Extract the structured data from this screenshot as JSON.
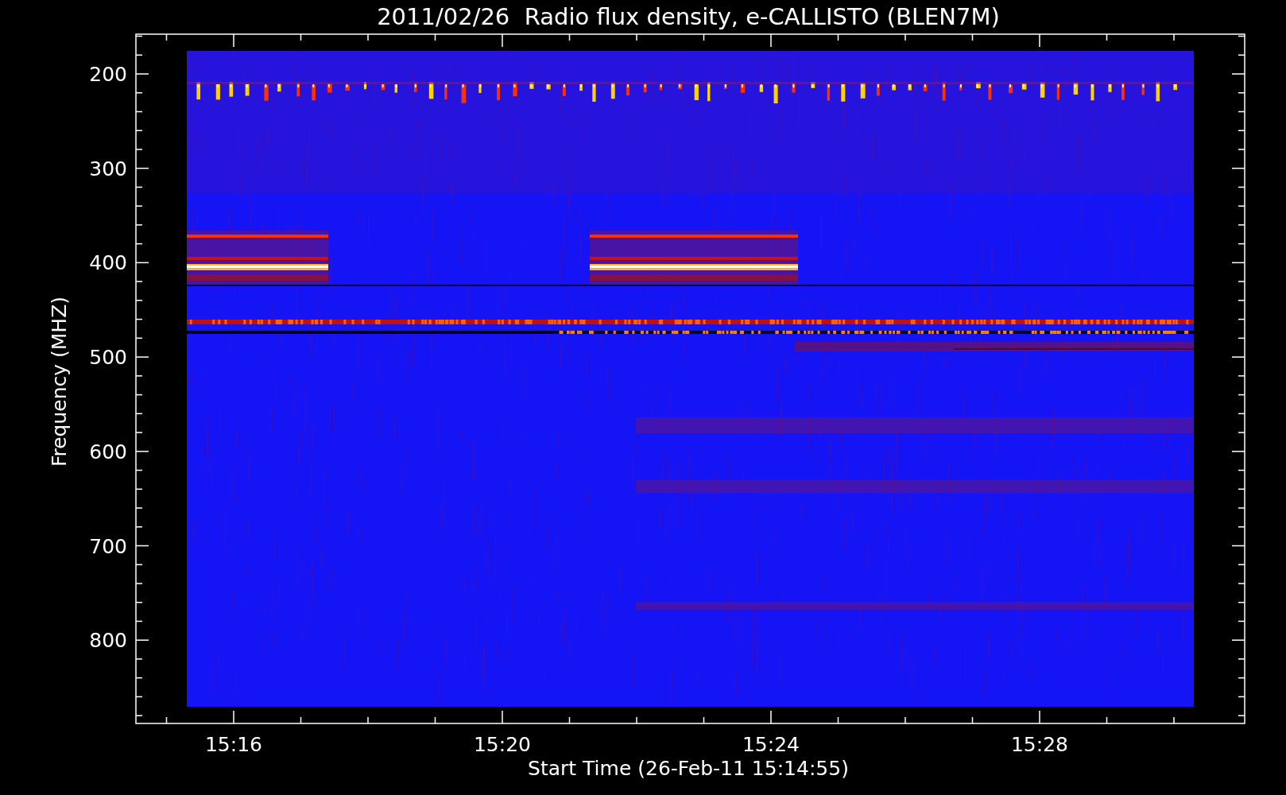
{
  "title": "2011/02/26  Radio flux density, e-CALLISTO (BLEN7M)",
  "y_axis": {
    "label": "Frequency (MHZ)",
    "ticks": [
      "200",
      "300",
      "400",
      "500",
      "600",
      "700",
      "800"
    ]
  },
  "x_axis": {
    "label": "Start Time (26-Feb-11 15:14:55)",
    "ticks": [
      "15:16",
      "15:20",
      "15:24",
      "15:28"
    ]
  }
}
